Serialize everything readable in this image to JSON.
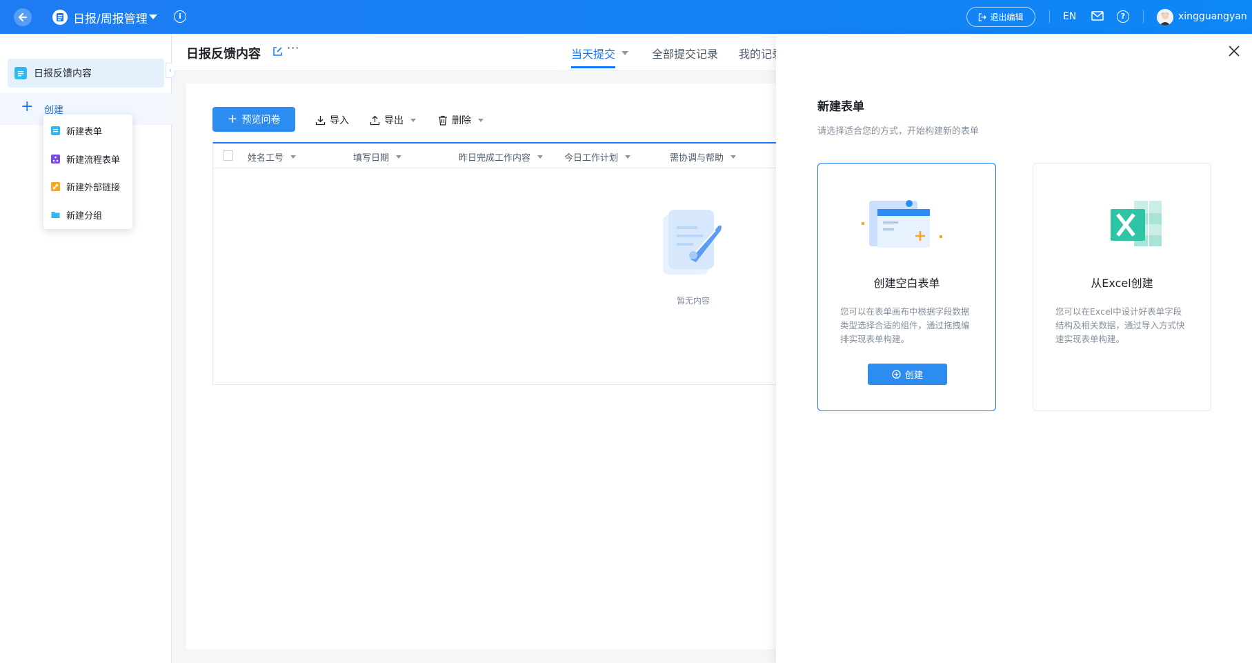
{
  "topbar": {
    "app_title": "日报/周报管理",
    "exit_edit_label": "退出编辑",
    "lang_label": "EN",
    "username": "xingguangyan"
  },
  "sidebar": {
    "items": [
      {
        "label": "日报反馈内容"
      }
    ],
    "create_label": "创建",
    "create_menu": [
      {
        "label": "新建表单",
        "icon": "form-icon",
        "color": "#2db7f5"
      },
      {
        "label": "新建流程表单",
        "icon": "workflow-icon",
        "color": "#7b4be0"
      },
      {
        "label": "新建外部链接",
        "icon": "link-icon",
        "color": "#f5a623"
      },
      {
        "label": "新建分组",
        "icon": "folder-icon",
        "color": "#2db7f5"
      }
    ]
  },
  "main": {
    "title": "日报反馈内容",
    "tabs": [
      {
        "label": "当天提交",
        "active": true
      },
      {
        "label": "全部提交记录",
        "active": false
      },
      {
        "label": "我的记录",
        "active": false
      }
    ],
    "toolbar": {
      "preview_label": "预览问卷",
      "import_label": "导入",
      "export_label": "导出",
      "delete_label": "删除"
    },
    "table": {
      "columns": [
        "姓名工号",
        "填写日期",
        "昨日完成工作内容",
        "今日工作计划",
        "需协调与帮助"
      ],
      "empty_text": "暂无内容"
    }
  },
  "drawer": {
    "title": "新建表单",
    "subtitle": "请选择适合您的方式，开始构建新的表单",
    "cards": [
      {
        "title": "创建空白表单",
        "description": "您可以在表单画布中根据字段数据类型选择合适的组件，通过拖拽编排实现表单构建。",
        "button_label": "创建",
        "selected": true
      },
      {
        "title": "从Excel创建",
        "description": "您可以在Excel中设计好表单字段结构及相关数据，通过导入方式快速实现表单构建。",
        "selected": false
      }
    ]
  },
  "colors": {
    "brand": "#1677ff",
    "topbar": "#0e87f7",
    "excel_green": "#2ec4a5"
  }
}
